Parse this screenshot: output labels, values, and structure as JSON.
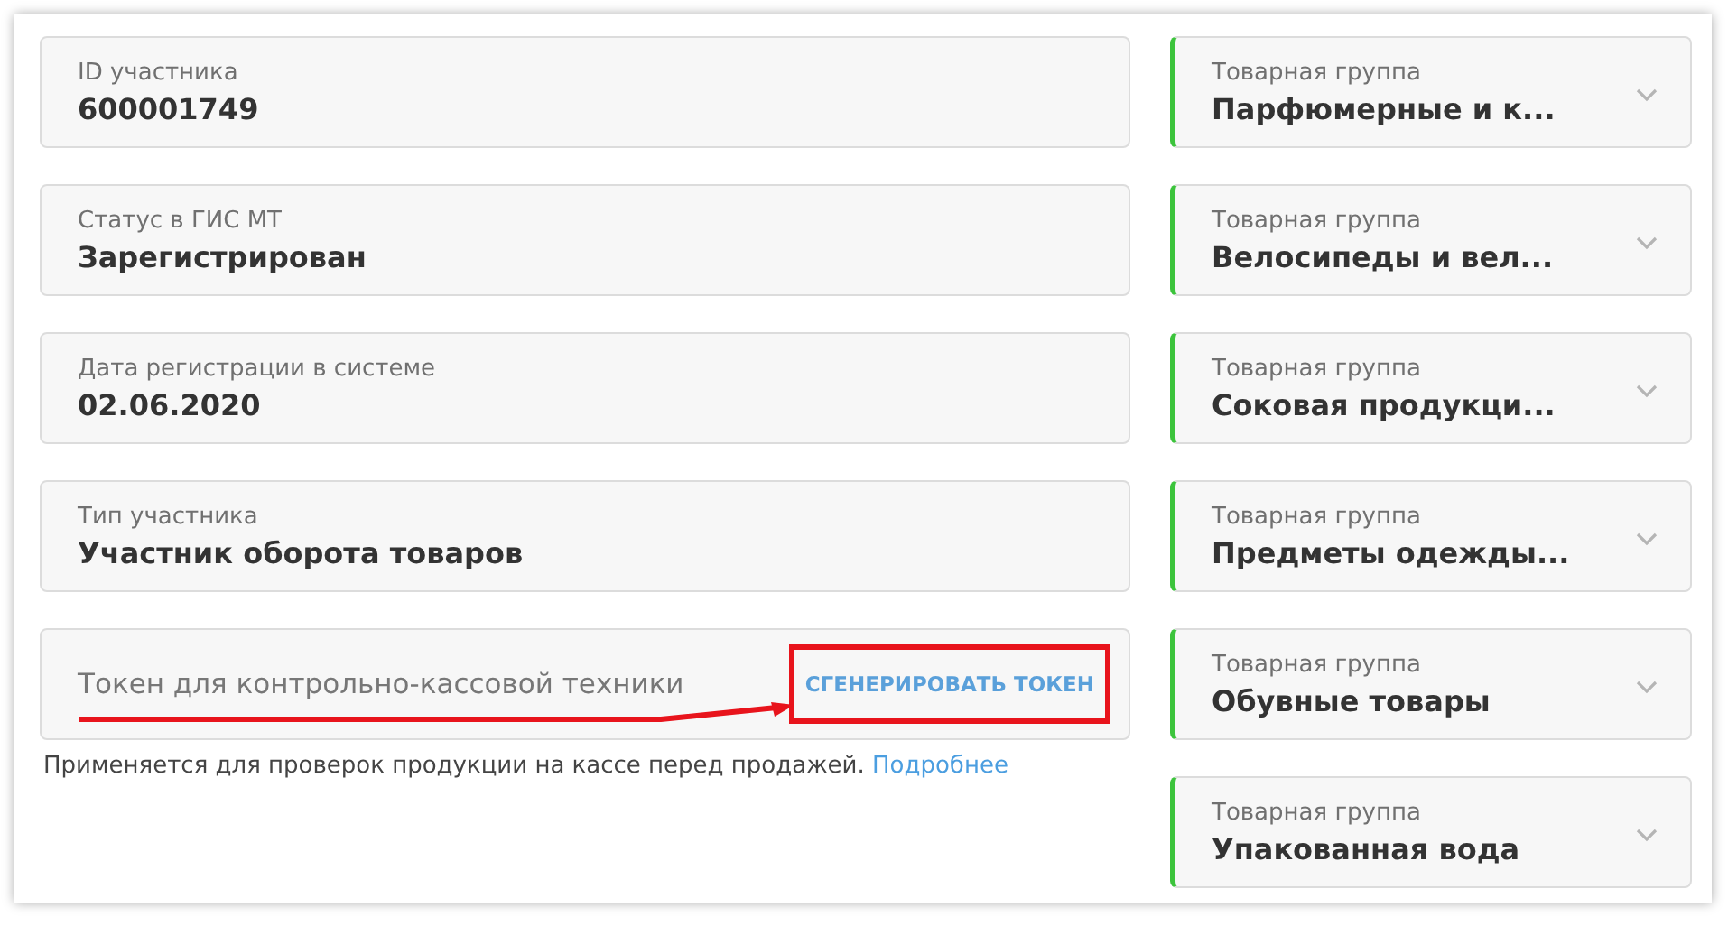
{
  "participant_fields": [
    {
      "label": "ID участника",
      "value": "600001749"
    },
    {
      "label": "Статус в ГИС МТ",
      "value": "Зарегистрирован"
    },
    {
      "label": "Дата регистрации в системе",
      "value": "02.06.2020"
    },
    {
      "label": "Тип участника",
      "value": "Участник оборота товаров"
    }
  ],
  "token": {
    "placeholder": "Токен для контрольно-кассовой техники",
    "button": "СГЕНЕРИРОВАТЬ ТОКЕН",
    "highlighted": true,
    "hint": "Применяется для проверок продукции на кассе перед продажей.",
    "link": "Подробнее"
  },
  "product_groups": [
    {
      "label": "Товарная группа",
      "value": "Парфюмерные и к...",
      "active": true
    },
    {
      "label": "Товарная группа",
      "value": "Велосипеды и вел...",
      "active": true
    },
    {
      "label": "Товарная группа",
      "value": "Соковая продукци...",
      "active": true
    },
    {
      "label": "Товарная группа",
      "value": "Предметы одежды...",
      "active": true
    },
    {
      "label": "Товарная группа",
      "value": "Обувные товары",
      "active": true
    },
    {
      "label": "Товарная группа",
      "value": "Упакованная вода",
      "active": true
    }
  ]
}
